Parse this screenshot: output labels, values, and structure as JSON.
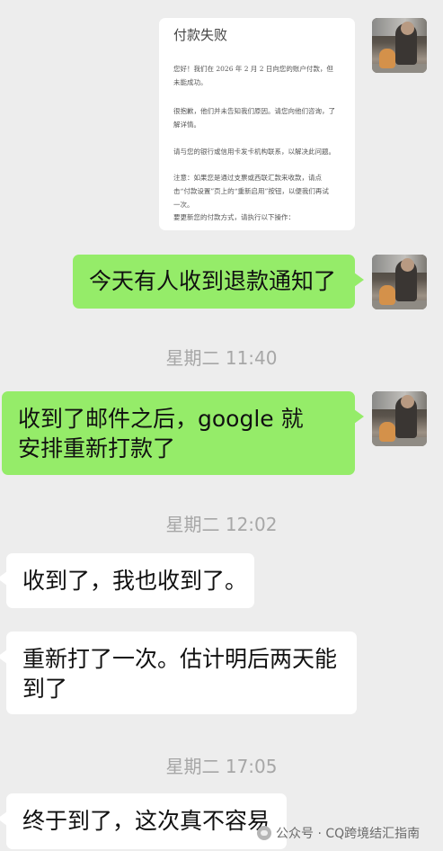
{
  "email": {
    "title": "付款失败",
    "paragraphs": [
      "您好！我们在 2026 年 2 月 2 日向您的账户付款，但未能成功。",
      "很抱歉，他们并未告知我们原因。请您向他们咨询，了解详情。",
      "请与您的银行或信用卡发卡机构联系，以解决此问题。",
      "注意：如果您是通过支票或西联汇款来收款，请点击“付款设置”页上的“重新启用”按钮，以便我们再试一次。",
      "要更新您的付款方式，请执行以下操作："
    ]
  },
  "messages": [
    {
      "side": "right",
      "text": "今天有人收到退款通知了"
    },
    {
      "time": "星期二 11:40"
    },
    {
      "side": "right",
      "text": "收到了邮件之后，google 就安排重新打款了"
    },
    {
      "time": "星期二 12:02"
    },
    {
      "side": "left",
      "text": "收到了，我也收到了。"
    },
    {
      "side": "left",
      "text": "重新打了一次。估计明后两天能到了"
    },
    {
      "time": "星期二 17:05"
    },
    {
      "side": "left",
      "text": "终于到了，这次真不容易"
    }
  ],
  "watermark": "公众号 · CQ跨境结汇指南",
  "colors": {
    "background": "#ededed",
    "self_bubble": "#95ec69",
    "other_bubble": "#ffffff",
    "timestamp": "#a7a7a7"
  }
}
